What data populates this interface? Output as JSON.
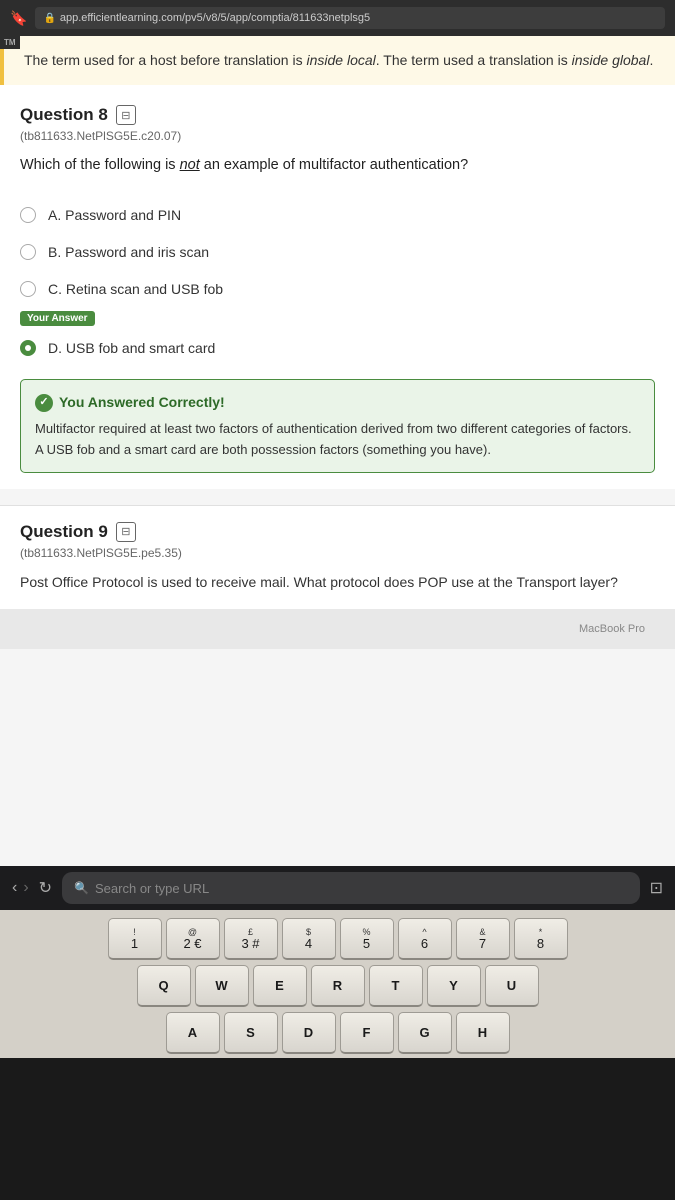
{
  "browser": {
    "url": "app.efficientlearning.com/pv5/v8/5/app/comptia/811633netplsg5",
    "bookmark_icon": "🔖",
    "lock_icon": "🔒"
  },
  "page": {
    "info_banner": {
      "text_before": "The term used for a host before translation is ",
      "term1": "inside local",
      "text_middle": ". The term used a translation is ",
      "term2": "inside global",
      "text_after": "."
    },
    "question8": {
      "label": "Question 8",
      "flag_icon": "⊟",
      "code": "(tb811633.NetPlSG5E.c20.07)",
      "text_before": "Which of the following is ",
      "emphasis": "not",
      "text_after": " an example of multifactor authentication?",
      "options": [
        {
          "id": "A",
          "text": "A. Password and PIN"
        },
        {
          "id": "B",
          "text": "B. Password and iris scan"
        },
        {
          "id": "C",
          "text": "C. Retina scan and USB fob"
        },
        {
          "id": "D",
          "text": "D. USB fob and smart card"
        }
      ],
      "your_answer_badge": "Your Answer",
      "selected_option": "D",
      "feedback": {
        "header": "You Answered Correctly!",
        "body": "Multifactor required at least two factors of authentication derived from two different categories of factors. A USB fob and a smart card are both possession factors (something you have)."
      }
    },
    "question9": {
      "label": "Question 9",
      "flag_icon": "⊟",
      "code": "(tb811633.NetPlSG5E.pe5.35)",
      "text": "Post Office Protocol is used to receive mail. What protocol does POP use at the Transport layer?"
    },
    "footer": {
      "macbook_label": "MacBook Pro"
    }
  },
  "touch_bar": {
    "back": "<",
    "forward": ">",
    "refresh": "↻",
    "search_placeholder": "Search or type URL"
  },
  "keyboard": {
    "row1": [
      {
        "top": "!",
        "bottom": "1"
      },
      {
        "top": "@",
        "bottom": "2 €"
      },
      {
        "top": "£",
        "bottom": "3 #"
      },
      {
        "top": "$",
        "bottom": "4"
      },
      {
        "top": "%",
        "bottom": "5"
      },
      {
        "top": "^",
        "bottom": "6"
      },
      {
        "top": "&",
        "bottom": "7"
      },
      {
        "top": "*",
        "bottom": "8"
      }
    ],
    "row2": [
      {
        "single": "Q"
      },
      {
        "single": "W"
      },
      {
        "single": "E"
      },
      {
        "single": "R"
      },
      {
        "single": "T"
      },
      {
        "single": "Y"
      },
      {
        "single": "U"
      }
    ],
    "row3": [
      {
        "single": "A"
      },
      {
        "single": "S"
      },
      {
        "single": "D"
      },
      {
        "single": "F"
      },
      {
        "single": "G"
      },
      {
        "single": "H"
      }
    ]
  }
}
